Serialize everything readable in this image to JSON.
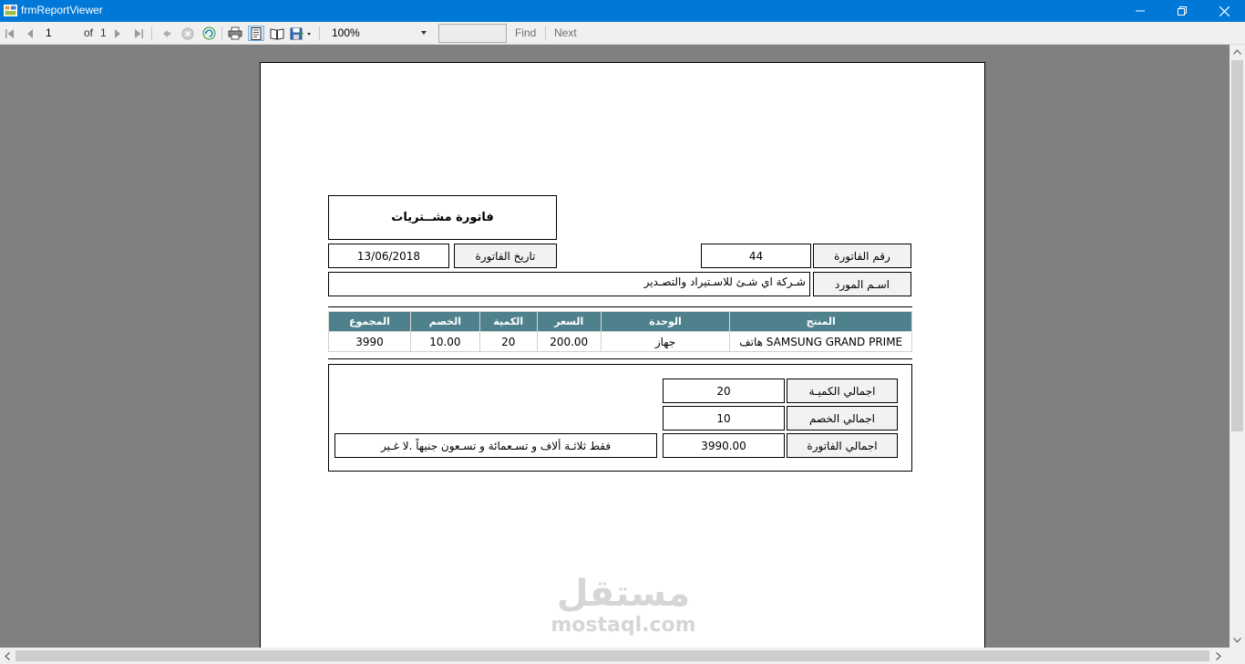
{
  "window": {
    "title": "frmReportViewer"
  },
  "toolbar": {
    "page_current": "1",
    "page_of_label": "of",
    "page_total": "1",
    "zoom_value": "100%",
    "find_value": "",
    "find_label": "Find",
    "next_label": "Next"
  },
  "report": {
    "title": "فاتورة مشــتريات",
    "invoice_number_label": "رقم  الفاتورة",
    "invoice_number": "44",
    "invoice_date_label": "تاريخ  الفاتورة",
    "invoice_date": "13/06/2018",
    "supplier_label": "اسـم  المورد",
    "supplier_name": "شـركة اي شـئ للاسـتيراد والتصـدير",
    "table": {
      "headers": {
        "product": "المنتج",
        "unit": "الوحدة",
        "price": "السعر",
        "quantity": "الكمية",
        "discount": "الخصم",
        "total": "المجموع"
      },
      "rows": [
        {
          "product": "SAMSUNG GRAND PRIME هاتف",
          "unit": "جهاز",
          "price": "200.00",
          "quantity": "20",
          "discount": "10.00",
          "total": "3990"
        }
      ]
    },
    "totals": {
      "quantity_label": "اجمالي الكميـة",
      "quantity_value": "20",
      "discount_label": "اجمالي  الخصم",
      "discount_value": "10",
      "invoice_label": "اجمالي  الفاتورة",
      "invoice_value": "3990.00",
      "amount_in_words": "فقط ثلاثـة ألاف و تسـعمائة و تسـعون جنيهاً .لا غـير"
    },
    "watermark": {
      "arabic": "مستقل",
      "latin": "mostaql.com"
    }
  },
  "colors": {
    "titlebar": "#0078d7",
    "table_header": "#4f818c",
    "viewport": "#808080"
  }
}
